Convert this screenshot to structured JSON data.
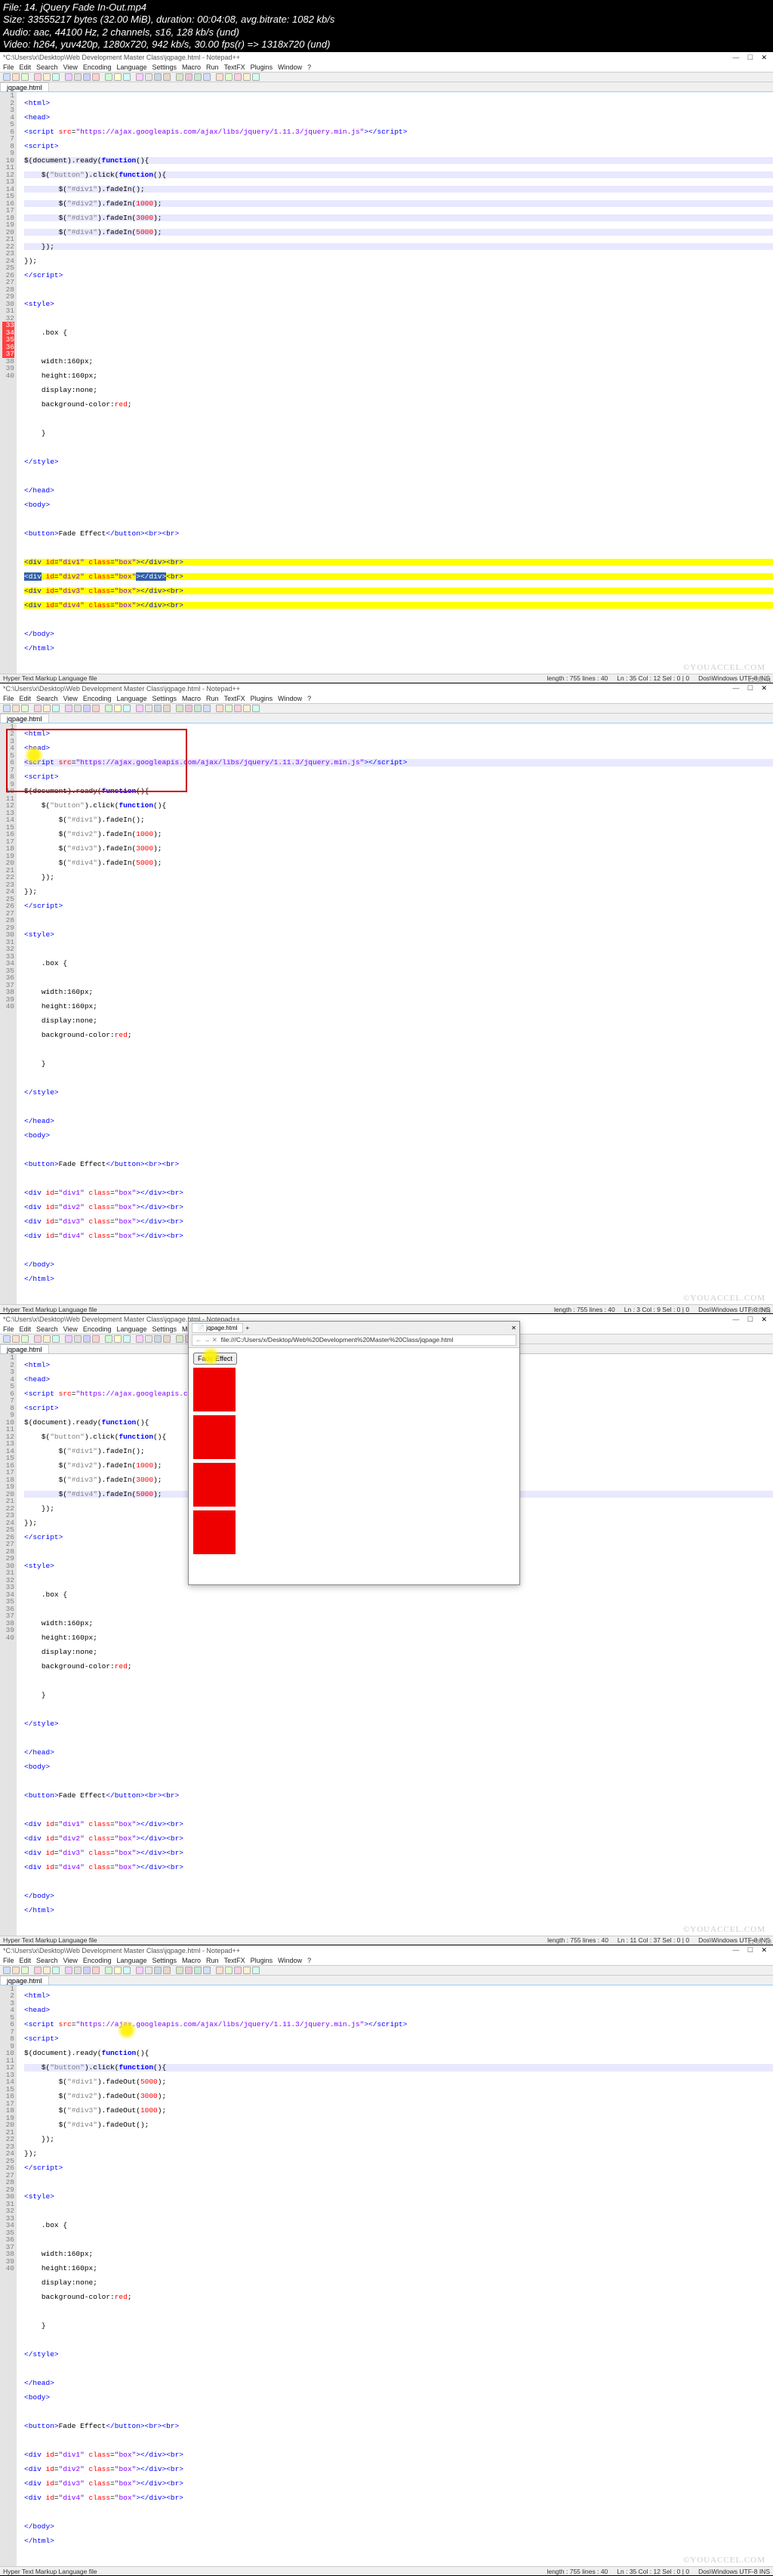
{
  "meta": {
    "file": "File: 14. jQuery Fade In-Out.mp4",
    "size": "Size: 33555217 bytes (32.00 MiB), duration: 00:04:08, avg.bitrate: 1082 kb/s",
    "audio": "Audio: aac, 44100 Hz, 2 channels, s16, 128 kb/s (und)",
    "video": "Video: h264, yuv420p, 1280x720, 942 kb/s, 30.00 fps(r) => 1318x720 (und)"
  },
  "title_path": "*C:\\Users\\x\\Desktop\\Web Development Master Class\\jqpage.html - Notepad++",
  "menubar": [
    "File",
    "Edit",
    "Search",
    "View",
    "Encoding",
    "Language",
    "Settings",
    "Macro",
    "Run",
    "TextFX",
    "Plugins",
    "Window",
    "?"
  ],
  "tab": "jqpage.html",
  "watermark": "©YOUACCEL.COM",
  "script_url": "https://ajax.googleapis.com/ajax/libs/jquery/1.11.3/jquery.min.js",
  "code": {
    "button_label": "Fade Effect",
    "css": {
      "selector": ".box {",
      "width": "width:160px;",
      "height": "height:160px;",
      "display": "display:none;",
      "bg": "background-color:red;"
    },
    "divs": [
      "div1",
      "div2",
      "div3",
      "div4"
    ]
  },
  "browser_url": "file:///C:/Users/x/Desktop/Web%20Development%20Master%20Class/jqpage.html",
  "statusbar": {
    "lang": "Hyper Text Markup Language file",
    "p1_len": "length : 755   lines : 40",
    "p1_pos": "Ln : 35   Col : 12   Sel : 0 | 0",
    "p2_len": "length : 755   lines : 40",
    "p2_pos": "Ln : 3   Col : 9   Sel : 0 | 0",
    "p3_len": "length : 755   lines : 40",
    "p3_pos": "Ln : 11   Col : 37   Sel : 0 | 0",
    "enc": "Dos\\Windows     UTF-8     INS"
  },
  "timestamps": [
    "22:30:41",
    "22:30:51",
    "22:31:13"
  ]
}
